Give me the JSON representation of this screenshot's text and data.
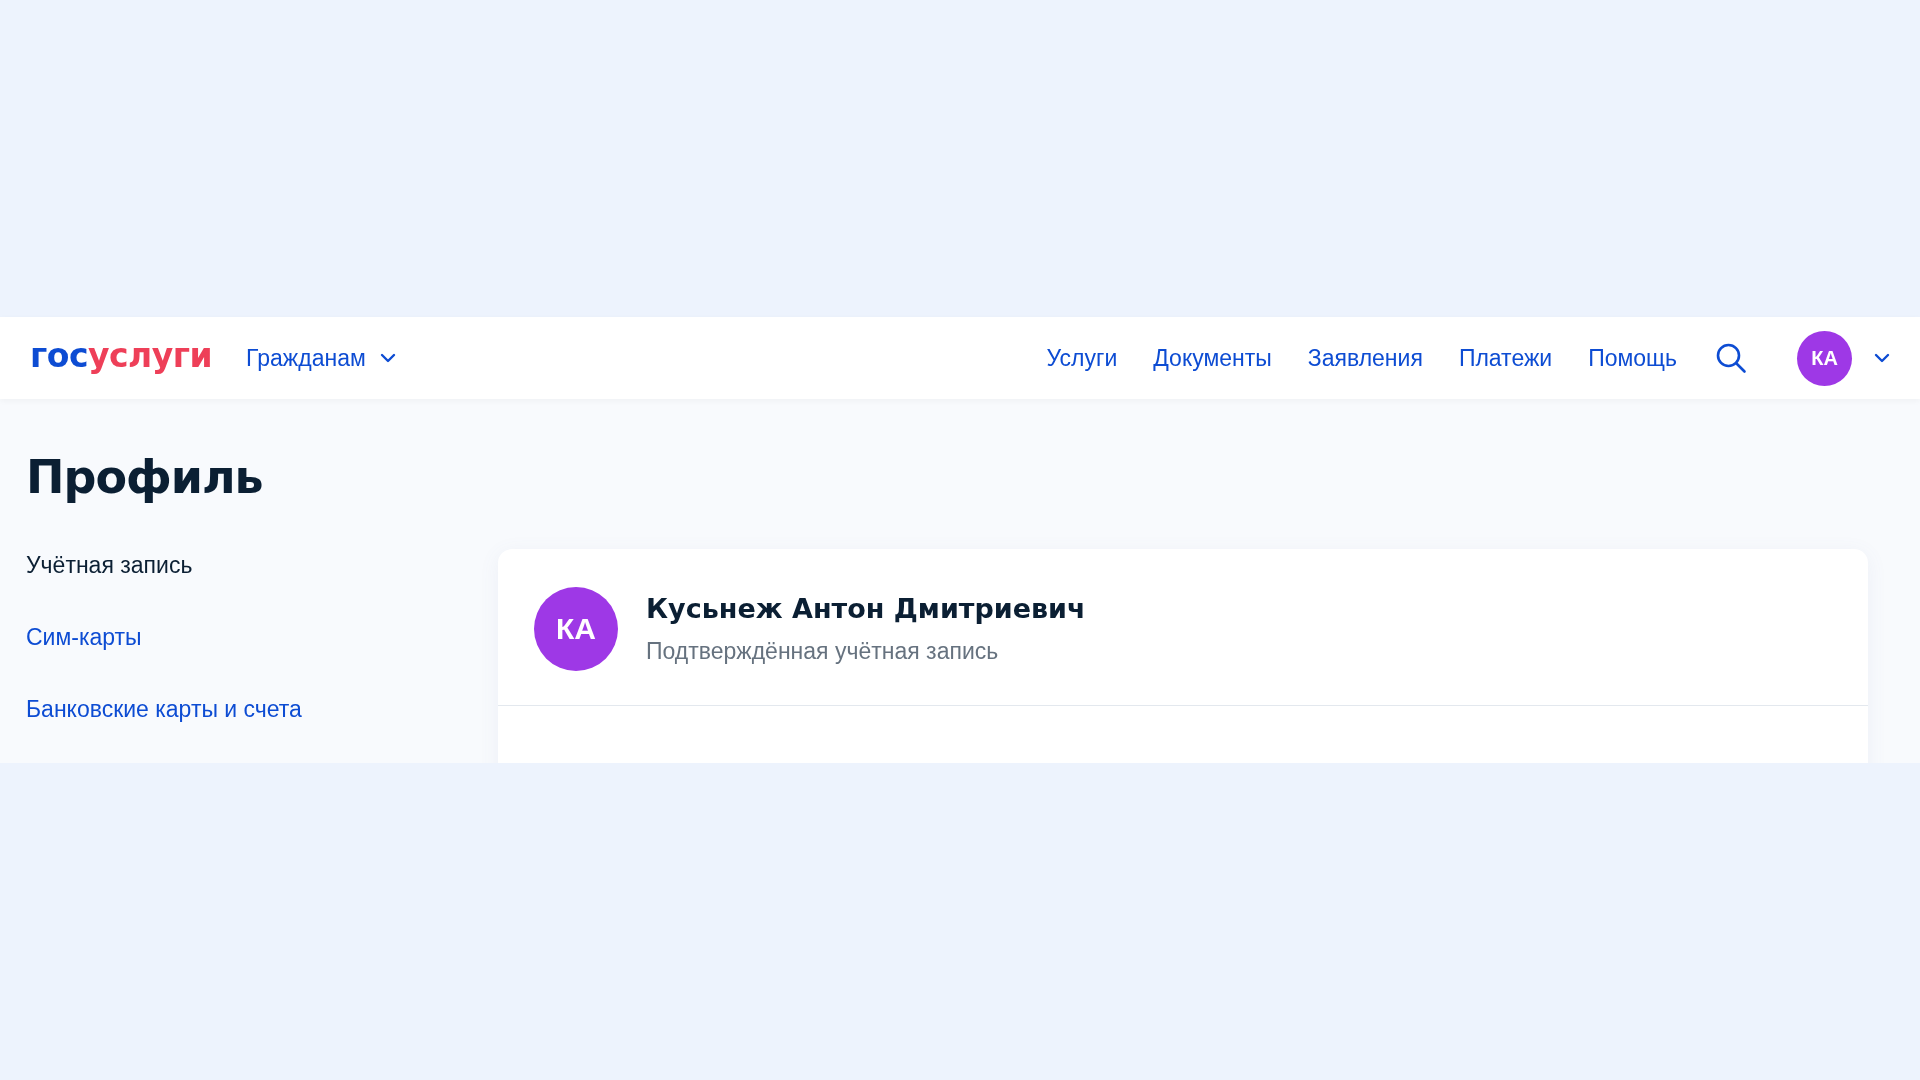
{
  "header": {
    "logo": {
      "prefix": "гос",
      "suffix": "услуги"
    },
    "audience_menu": "Гражданам",
    "nav": [
      "Услуги",
      "Документы",
      "Заявления",
      "Платежи",
      "Помощь"
    ],
    "user_initials": "КА"
  },
  "page_title": "Профиль",
  "sidebar": {
    "items": [
      {
        "label": "Учётная запись",
        "selected": true
      },
      {
        "label": "Сим-карты",
        "selected": false
      },
      {
        "label": "Банковские карты и счета",
        "selected": false
      }
    ]
  },
  "profile_card": {
    "initials": "КА",
    "name": "Кусьнеж Антон Дмитриевич",
    "status": "Подтверждённая учётная запись"
  }
}
